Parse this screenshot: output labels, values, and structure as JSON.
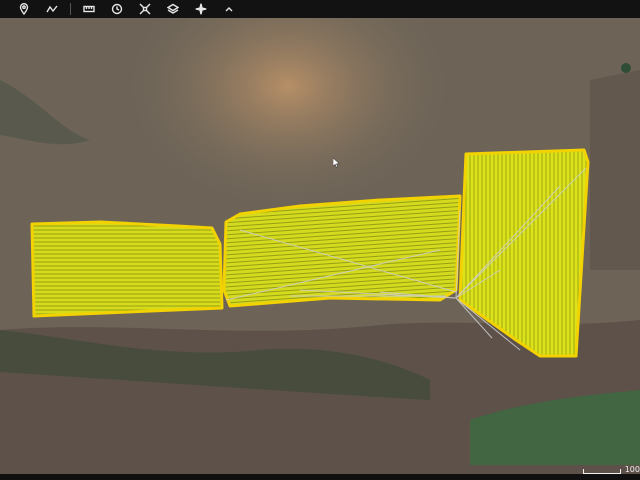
{
  "toolbar": {
    "items": [
      {
        "icon": "location-pin-icon"
      },
      {
        "icon": "path-icon"
      },
      {
        "icon": "ruler-icon"
      },
      {
        "icon": "history-icon"
      },
      {
        "icon": "satellite-icon"
      },
      {
        "icon": "layers-icon"
      },
      {
        "icon": "sparkle-icon"
      },
      {
        "icon": "chevron-up-icon"
      }
    ]
  },
  "scale": {
    "label": "100"
  },
  "colors": {
    "field_fill": "#d9de1e",
    "field_outline": "#f0d000",
    "path_lines": "#c8c8c8",
    "terrain": "#6f6659"
  }
}
